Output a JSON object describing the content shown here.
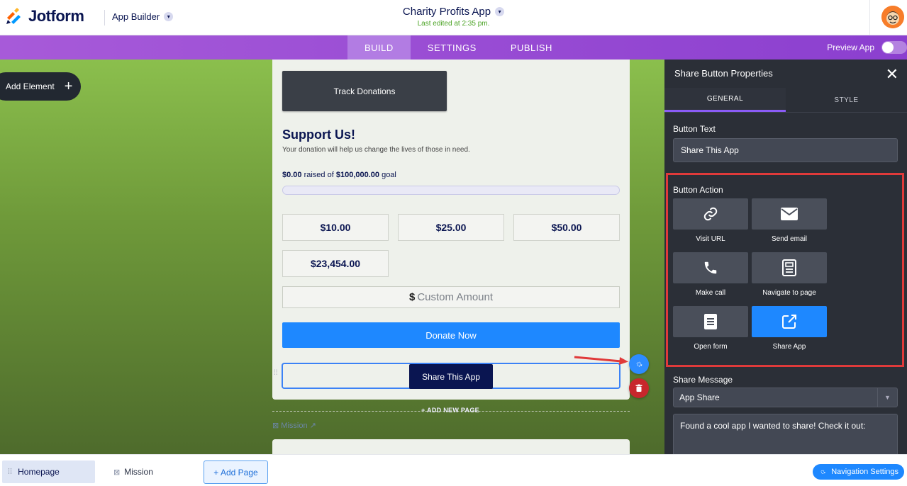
{
  "brand": {
    "name": "Jotform",
    "product": "App Builder"
  },
  "app": {
    "title": "Charity Profits App",
    "last_edited": "Last edited at 2:35 pm."
  },
  "nav": {
    "tabs": [
      "BUILD",
      "SETTINGS",
      "PUBLISH"
    ],
    "active_tab": "BUILD",
    "preview_label": "Preview App"
  },
  "canvas": {
    "add_element_label": "Add Element",
    "track_button": "Track Donations",
    "support_title": "Support Us!",
    "support_subtitle": "Your donation will help us change the lives of those in need.",
    "raised_amount": "$0.00",
    "raised_mid": " raised of ",
    "goal_amount": "$100,000.00",
    "raised_suffix": " goal",
    "progress": 0,
    "amounts": [
      "$10.00",
      "$25.00",
      "$50.00",
      "$23,454.00"
    ],
    "custom_currency": "$",
    "custom_amount": "Custom Amount",
    "donate_label": "Donate Now",
    "share_button": "Share This App",
    "add_new_page": "+ ADD NEW PAGE",
    "next_page": "Mission"
  },
  "panel": {
    "title": "Share Button Properties",
    "tabs": [
      "GENERAL",
      "STYLE"
    ],
    "active_tab": "GENERAL",
    "button_text_label": "Button Text",
    "button_text_value": "Share This App",
    "button_action_label": "Button Action",
    "actions": [
      {
        "label": "Visit URL",
        "icon": "link-icon",
        "selected": false
      },
      {
        "label": "Send email",
        "icon": "mail-icon",
        "selected": false
      },
      {
        "label": "Make call",
        "icon": "phone-icon",
        "selected": false
      },
      {
        "label": "Navigate to page",
        "icon": "page-icon",
        "selected": false
      },
      {
        "label": "Open form",
        "icon": "form-icon",
        "selected": false
      },
      {
        "label": "Share App",
        "icon": "share-icon",
        "selected": true
      }
    ],
    "share_message_label": "Share Message",
    "share_message_select": "App Share",
    "share_message_text": "Found a cool app I wanted to share! Check it out:"
  },
  "bottom": {
    "pages": [
      "Homepage",
      "Mission"
    ],
    "add_page_label": "+ Add Page",
    "nav_settings_label": "Navigation Settings"
  },
  "colors": {
    "accent_purple": "#8b3fcf",
    "primary_blue": "#1e88ff",
    "navy": "#0a1551",
    "highlight_red": "#e03a3a"
  }
}
